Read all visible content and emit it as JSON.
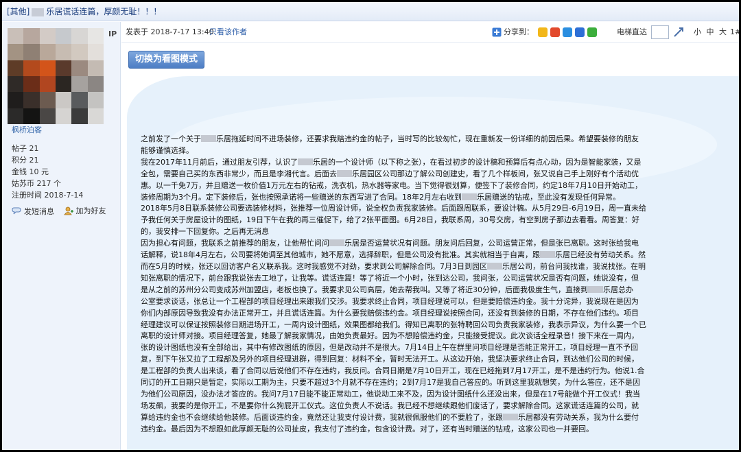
{
  "thread": {
    "title_prefix": "[其他]",
    "title_rest": "乐居谎话连篇，厚颜无耻！！！"
  },
  "user": {
    "ip_label": "IP",
    "username": "枫桥泊客",
    "stats": [
      {
        "label": "帖子",
        "value": "21"
      },
      {
        "label": "积分",
        "value": "21"
      },
      {
        "label": "金钱",
        "value": "10 元"
      },
      {
        "label": "姑苏币",
        "value": "217 个"
      },
      {
        "label": "注册时间",
        "value": "2018-7-14"
      }
    ],
    "actions": {
      "message": "发短消息",
      "add_friend": "加为好友"
    },
    "avatar_colors": [
      "#c9bfb8",
      "#b7a79e",
      "#d3cbc6",
      "#c6c9cd",
      "#d8d6d4",
      "#e7e6e4",
      "#a39383",
      "#8f8074",
      "#b9a89a",
      "#c7bcb2",
      "#d2c9c0",
      "#e3dfdb",
      "#5e3c27",
      "#b34a1d",
      "#d3541a",
      "#5a3a2c",
      "#9b8a80",
      "#c4bbb3",
      "#2f2a27",
      "#6b2d18",
      "#b14620",
      "#2b2622",
      "#a6a29f",
      "#8b8683",
      "#1f1d1c",
      "#3a2f2a",
      "#6c5b50",
      "#cbc8c5",
      "#595b5d",
      "#c4c3c1",
      "#2b2a29",
      "#141413",
      "#4a4745",
      "#d6d4d2",
      "#3b3b3b",
      "#d9d8d6"
    ]
  },
  "post_header": {
    "posted_at": "发表于 2018-7-17 13:40",
    "author_only": "只看该作者",
    "share_label": "分享到：",
    "share_icon_colors": [
      "#f2b71a",
      "#e24a2d",
      "#2a8ee0",
      "#2d6fd6",
      "#3cae3c"
    ],
    "elevator": "电梯直达",
    "font_sizes": "小 中 大",
    "floor": "1#"
  },
  "content": {
    "switch_button": "切换为看图模式",
    "lines": [
      [
        "之前发了一个关于",
        "乐居拖延时间不进场装修，还要求我赔违约金的帖子，当时写的比较匆忙，现在重新发一份详细的前因后果。希望要装修的朋友"
      ],
      [
        "能够谨慎选择。"
      ],
      [
        "我在2017年11月前后，通过朋友引荐，认识了",
        "乐居的一个设计师（以下称之张），在看过初步的设计稿和预算后有点心动，因为是智能家装，又是"
      ],
      [
        "全包，需要自己买的东西非常少，而且是李湘代言。后面去",
        "乐居园区公司那边了解公司创建史，看了几个样板间，张又说自己手上刚好有个活动优"
      ],
      [
        "惠。以一千免7万，并且赠送一枚价值1万元左右的钻戒，洗衣机，热水器等家电。当下觉得很划算，便签下了装修合同，约定18年7月10日开始动工，"
      ],
      [
        "装修周期为3个月。定下装修后，张也按照承诺将一些赠送的东西写进了合同。18年2月左右收到",
        "乐居赠送的钻戒，至此没有发现任何异常。"
      ],
      [
        "2018年5月8日联系装修公司要选装修材料，张推荐一位周设计师，说全权负责我家装修。后面跟周联系，要设计稿。从5月29日-6月19日，周一直未给"
      ],
      [
        "予我任何关于房屋设计的图纸，19日下午在我的再三催促下，给了2张平面图。6月28日，我联系周，30号交房，有空到房子那边去看看。周答复：好"
      ],
      [
        "的，我安排一下回复你。之后再无消息"
      ],
      [
        "因为担心有问题，我联系之前推荐的朋友，让他帮忙问问",
        "乐居是否运营状况有问题。朋友问后回复，公司运营正常，但是张已离职。这时张给我电"
      ],
      [
        "话解释，说18年4月左右，公司要将她调至其他城市，她不愿意，选择辞职，但是公司没有批准。其实就相当于自离，跟",
        "乐居已经没有劳动关系。然"
      ],
      [
        "而在5月的时候，张还以回访客户名义联系我。这时我感觉不对劲，要求到公司解除合同。7月3日到园区",
        "乐居公司，前台问我找谁，我说找张。在明"
      ],
      [
        "知张离职的情况下，前台跟我说张去工地了，让我等。谎话连篇！等了将近一个小时，张到达公司，我问张，公司运营状况是否有问题，她说没有，但"
      ],
      [
        "是从之前的苏州分公司变成苏州加盟店，老板也换了。我要求见公司高层，她去帮我叫。又等了将近30分钟，后面我极度生气，直接到",
        "乐居总办"
      ],
      [
        "公室要求谈话，张总让一个工程部的项目经理出来跟我们交涉。我要求终止合同，项目经理说可以，但是要赔偿违约金。我十分诧异，我说现在是因为"
      ],
      [
        "你们内部原因导致我没有办法正常开工，并且谎话连篇。为什么要我赔偿违约金。项目经理说按照合同，还没有到装修的日期，不存在他们违约。项目"
      ],
      [
        "经理建议可以保证按照装修日期进场开工，一周内设计图纸，效果图都给我们。得知已离职的张特聘回公司负责我家装修，我表示异议，为什么要一个已"
      ],
      [
        "离职的设计师对接。项目经理答复，她最了解我家情况，由她负责最好。因为不想赔偿违约金，只能接受提议。此次谈话全程录音！接下来在一周内，"
      ],
      [
        "张的设计图纸也没有全部给出，其中有修改图纸的原因，但是改动并不是很大。7月14日上午在群里问项目经理是否能正常开工，项目经理一直不予回"
      ],
      [
        "复，到下午张又拉了工程部及另外的项目经理进群，得到回复：材料不全，暂时无法开工。从这边开始，我坚决要求终止合同，到达他们公司的时候，"
      ],
      [
        "是工程部的负责人出来谈，看了合同以后说他们不存在违约，我反问。合同日期是7月10日开工，现在已经拖到7月17开工，是不是违约行为。他说1.合"
      ],
      [
        "同订的开工日期只是暂定，实际以工期为主，只要不超过3个月就不存在违约；2到7月17是我自己答应的。听到这里我就想笑，为什么答应，还不是因"
      ],
      [
        "为他们公司原因，没办法才答应的。我问7月17日能不能正常动工，他说动工来不及，因为设计图纸什么还没出来，但是在17号能做个开工仪式！我当"
      ],
      [
        "场发飙，我要的是你开工，不是要你什么狗屁开工仪式。这位负责人不说话。我已经不想继续跟他们废话了，要求解除合同。这家谎话连篇的公司，就"
      ],
      [
        "算给违约金也不会继续给他装修。后面谈违约金，竟然还让我支付设计费，我就很佩服他们的不要脸了，张跟",
        "乐居都没有劳动关系，我为什么要付"
      ],
      [
        "违约金。最后因为不想跟如此厚颜无耻的公司扯皮，我支付了违约金，包含设计费。对了，还有当时赠送的钻戒，这家公司也一并要回。"
      ]
    ]
  }
}
